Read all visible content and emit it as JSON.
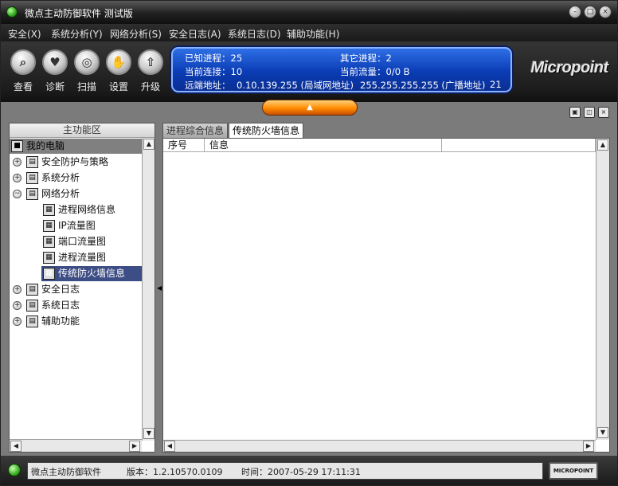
{
  "window": {
    "title": "微点主动防御软件  测试版"
  },
  "menu": [
    "安全(X)",
    "系统分析(Y)",
    "网络分析(S)",
    "安全日志(A)",
    "系统日志(D)",
    "辅助功能(H)"
  ],
  "toolbar": {
    "buttons": [
      {
        "label": "查看",
        "icon": "magnifier-icon"
      },
      {
        "label": "诊断",
        "icon": "heartbeat-icon"
      },
      {
        "label": "扫描",
        "icon": "scan-icon"
      },
      {
        "label": "设置",
        "icon": "hand-icon"
      },
      {
        "label": "升级",
        "icon": "upgrade-icon"
      }
    ]
  },
  "info": {
    "known_processes": "已知进程：25",
    "other_processes": "其它进程：2",
    "current_connections": "当前连接：10",
    "current_traffic": "当前流量：0/0 B",
    "remote_addr_label": "远端地址：",
    "remote_lan": "0.10.139.255 (局域网地址)",
    "remote_broadcast": "255.255.255.255 (广播地址)",
    "remote_count": "21"
  },
  "logo": "Micropoint",
  "left_panel": {
    "header": "主功能区",
    "tree": [
      {
        "label": "我的电脑",
        "level": 0,
        "expander": "",
        "state": "root"
      },
      {
        "label": "安全防护与策略",
        "level": 1,
        "expander": "+",
        "state": ""
      },
      {
        "label": "系统分析",
        "level": 1,
        "expander": "+",
        "state": ""
      },
      {
        "label": "网络分析",
        "level": 1,
        "expander": "-",
        "state": ""
      },
      {
        "label": "进程网络信息",
        "level": 2,
        "expander": "",
        "state": ""
      },
      {
        "label": "IP流量图",
        "level": 2,
        "expander": "",
        "state": ""
      },
      {
        "label": "端口流量图",
        "level": 2,
        "expander": "",
        "state": ""
      },
      {
        "label": "进程流量图",
        "level": 2,
        "expander": "",
        "state": ""
      },
      {
        "label": "传统防火墙信息",
        "level": 2,
        "expander": "",
        "state": "selected"
      },
      {
        "label": "安全日志",
        "level": 1,
        "expander": "+",
        "state": ""
      },
      {
        "label": "系统日志",
        "level": 1,
        "expander": "+",
        "state": ""
      },
      {
        "label": "辅助功能",
        "level": 1,
        "expander": "+",
        "state": ""
      }
    ]
  },
  "right_panel": {
    "tabs": [
      {
        "label": "进程综合信息",
        "active": false
      },
      {
        "label": "传统防火墙信息",
        "active": true
      }
    ],
    "columns": [
      "序号",
      "信息",
      ""
    ]
  },
  "status": {
    "app_name": "微点主动防御软件",
    "version": "版本：1.2.10570.0109",
    "time": "时间：2007-05-29 17:11:31",
    "logo": "MICROPOINT"
  }
}
